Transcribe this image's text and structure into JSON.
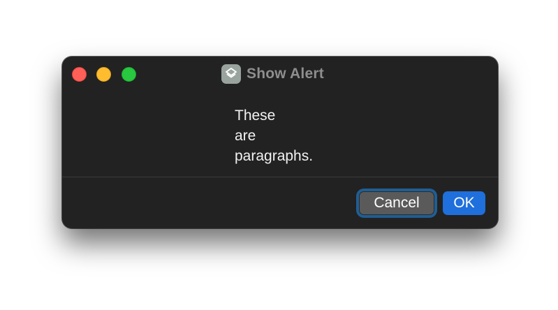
{
  "window": {
    "title": "Show Alert",
    "app_icon": "shortcuts-layers-icon"
  },
  "message": {
    "lines": [
      "These",
      "are",
      "paragraphs."
    ]
  },
  "buttons": {
    "cancel_label": "Cancel",
    "ok_label": "OK"
  },
  "colors": {
    "window_background": "#222222",
    "close": "#fe5f57",
    "minimize": "#febc2e",
    "zoom": "#28c840",
    "primary_button": "#1f6fdc",
    "focus_ring": "#1f5e94"
  }
}
